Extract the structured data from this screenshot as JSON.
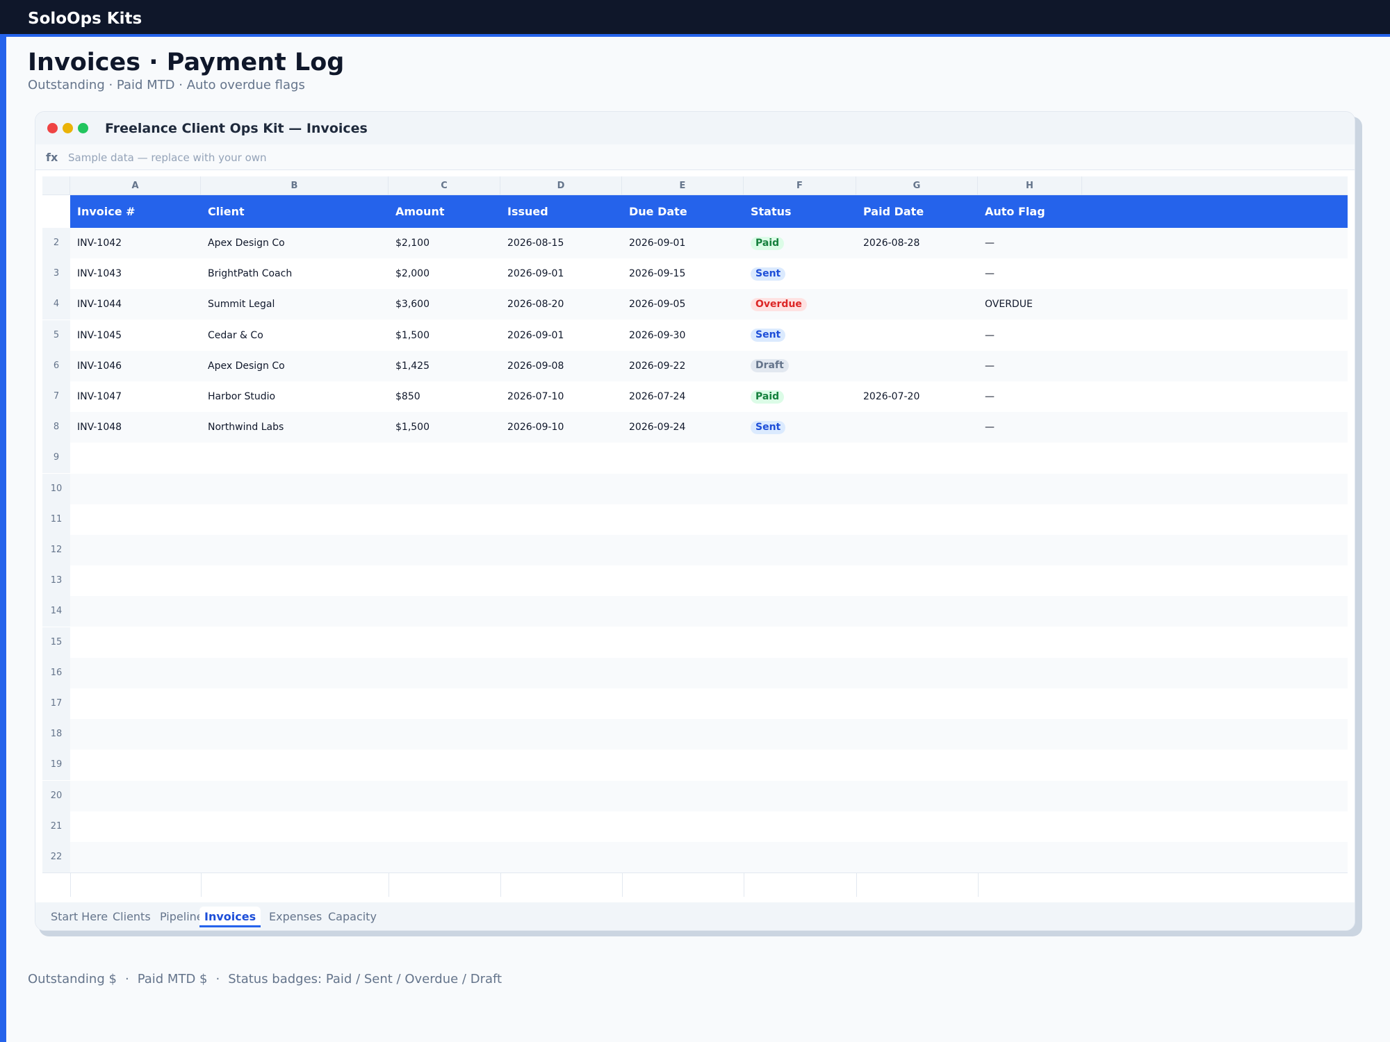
{
  "app": {
    "brand": "SoloOps Kits"
  },
  "page": {
    "title": "Invoices · Payment Log",
    "subtitle": "Outstanding · Paid MTD · Auto overdue flags"
  },
  "window": {
    "title": "Freelance Client Ops Kit — Invoices",
    "formula_label": "fx",
    "formula_text": "Sample data — replace with your own"
  },
  "sheet": {
    "column_letters": [
      "A",
      "B",
      "C",
      "D",
      "E",
      "F",
      "G",
      "H"
    ],
    "headers": [
      "Invoice #",
      "Client",
      "Amount",
      "Issued",
      "Due Date",
      "Status",
      "Paid Date",
      "Auto Flag"
    ],
    "rows": [
      {
        "num": "2",
        "invoice": "INV-1042",
        "client": "Apex Design Co",
        "amount": "$2,100",
        "issued": "2026-08-15",
        "due": "2026-09-01",
        "status": "Paid",
        "paid_date": "2026-08-28",
        "flag": "—"
      },
      {
        "num": "3",
        "invoice": "INV-1043",
        "client": "BrightPath Coach",
        "amount": "$2,000",
        "issued": "2026-09-01",
        "due": "2026-09-15",
        "status": "Sent",
        "paid_date": "",
        "flag": "—"
      },
      {
        "num": "4",
        "invoice": "INV-1044",
        "client": "Summit Legal",
        "amount": "$3,600",
        "issued": "2026-08-20",
        "due": "2026-09-05",
        "status": "Overdue",
        "paid_date": "",
        "flag": "OVERDUE"
      },
      {
        "num": "5",
        "invoice": "INV-1045",
        "client": "Cedar & Co",
        "amount": "$1,500",
        "issued": "2026-09-01",
        "due": "2026-09-30",
        "status": "Sent",
        "paid_date": "",
        "flag": "—"
      },
      {
        "num": "6",
        "invoice": "INV-1046",
        "client": "Apex Design Co",
        "amount": "$1,425",
        "issued": "2026-09-08",
        "due": "2026-09-22",
        "status": "Draft",
        "paid_date": "",
        "flag": "—"
      },
      {
        "num": "7",
        "invoice": "INV-1047",
        "client": "Harbor Studio",
        "amount": "$850",
        "issued": "2026-07-10",
        "due": "2026-07-24",
        "status": "Paid",
        "paid_date": "2026-07-20",
        "flag": "—"
      },
      {
        "num": "8",
        "invoice": "INV-1048",
        "client": "Northwind Labs",
        "amount": "$1,500",
        "issued": "2026-09-10",
        "due": "2026-09-24",
        "status": "Sent",
        "paid_date": "",
        "flag": "—"
      }
    ],
    "empty_row_numbers": [
      "9",
      "10",
      "11",
      "12",
      "13",
      "14",
      "15",
      "16",
      "17",
      "18",
      "19",
      "20",
      "21",
      "22"
    ]
  },
  "tabs": [
    {
      "label": "Start Here",
      "active": false
    },
    {
      "label": "Clients",
      "active": false
    },
    {
      "label": "Pipeline",
      "active": false
    },
    {
      "label": "Invoices",
      "active": true
    },
    {
      "label": "Expenses",
      "active": false
    },
    {
      "label": "Capacity",
      "active": false
    }
  ],
  "footer": {
    "items": [
      "Outstanding $",
      "Paid MTD $",
      "Status badges: Paid / Sent / Overdue / Draft"
    ],
    "separator": "·"
  },
  "colors": {
    "accent": "#2563eb",
    "topbar": "#0f172a",
    "paid": "#15803d",
    "sent": "#1d4ed8",
    "overdue": "#dc2626",
    "draft": "#64748b"
  }
}
